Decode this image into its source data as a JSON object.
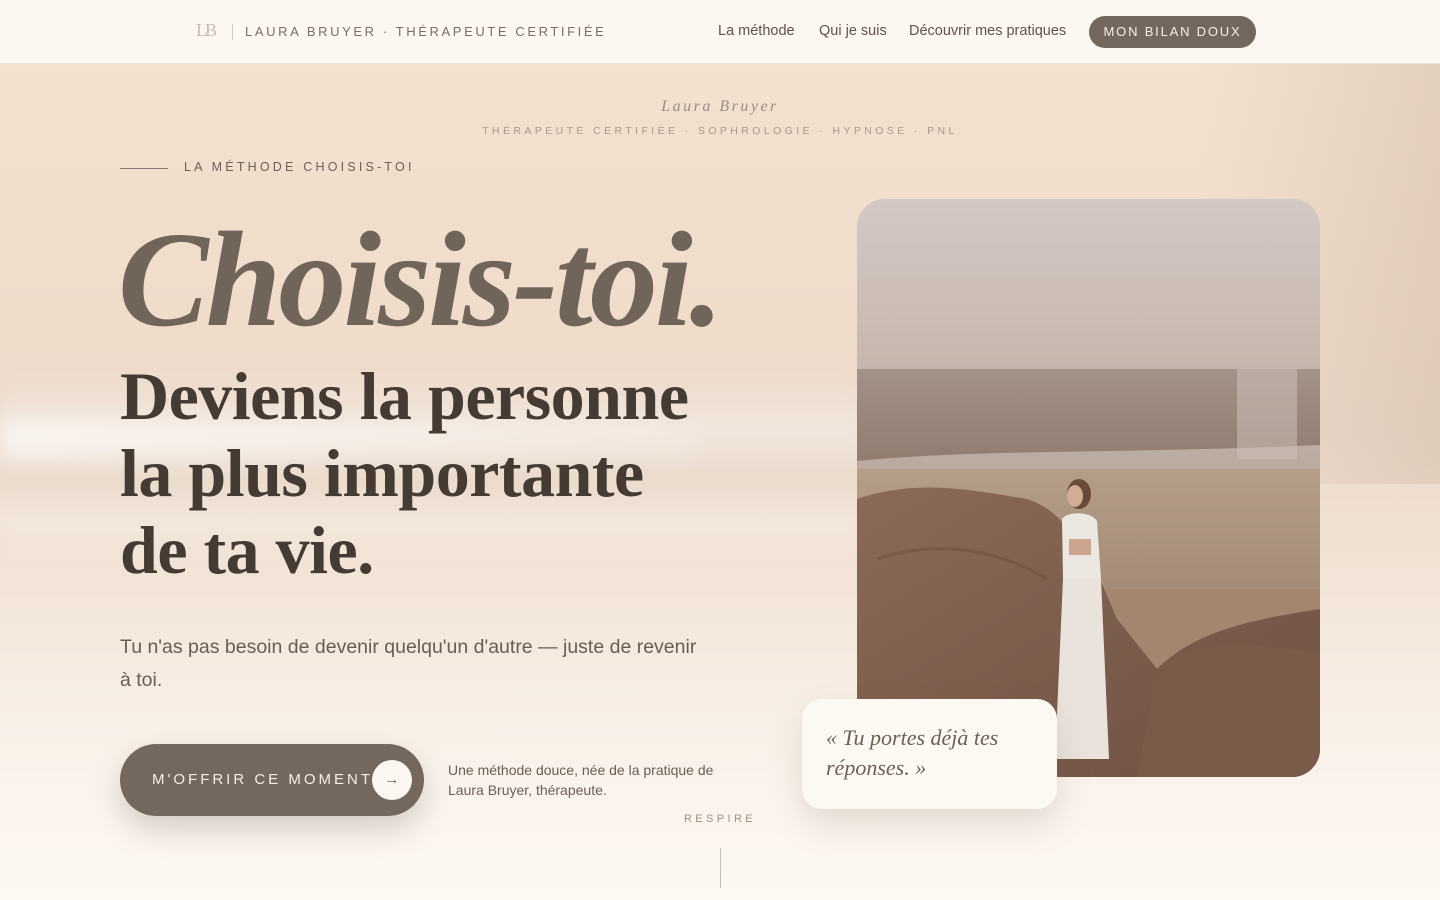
{
  "header": {
    "logo_mark": "LB",
    "brand": "LAURA BRUYER · THÉRAPEUTE CERTIFIÉE",
    "nav": [
      "La méthode",
      "Qui je suis",
      "Découvrir mes pratiques"
    ],
    "cta": "MON BILAN DOUX"
  },
  "identity": {
    "name": "Laura Bruyer",
    "subtitle": "THÉRAPEUTE CERTIFIÉE · SOPHROLOGIE · HYPNOSE · PNL"
  },
  "hero": {
    "eyebrow": "LA MÉTHODE CHOISIS-TOI",
    "title_script": "Choisis-toi.",
    "headline_lines": [
      "Deviens la personne",
      "la plus importante",
      "de ta vie."
    ],
    "lead": "Tu n'as pas besoin de devenir quelqu'un d'autre — juste de revenir à toi.",
    "cta_label": "M'OFFRIR CE MOMENT",
    "cta_arrow": "→",
    "cta_note": "Une méthode douce, née de la pratique de Laura Bruyer, thérapeute.",
    "scroll_label": "RESPIRE"
  },
  "quote": {
    "text": "« Tu portes déjà tes réponses. »"
  },
  "colors": {
    "accent": "#74675e",
    "header_bg": "#fcf7f1",
    "heading": "#463b33",
    "card_bg": "#fcf8f2"
  },
  "icons": {
    "cta_arrow": "arrow-right-icon",
    "logo": "monogram-logo-icon"
  }
}
